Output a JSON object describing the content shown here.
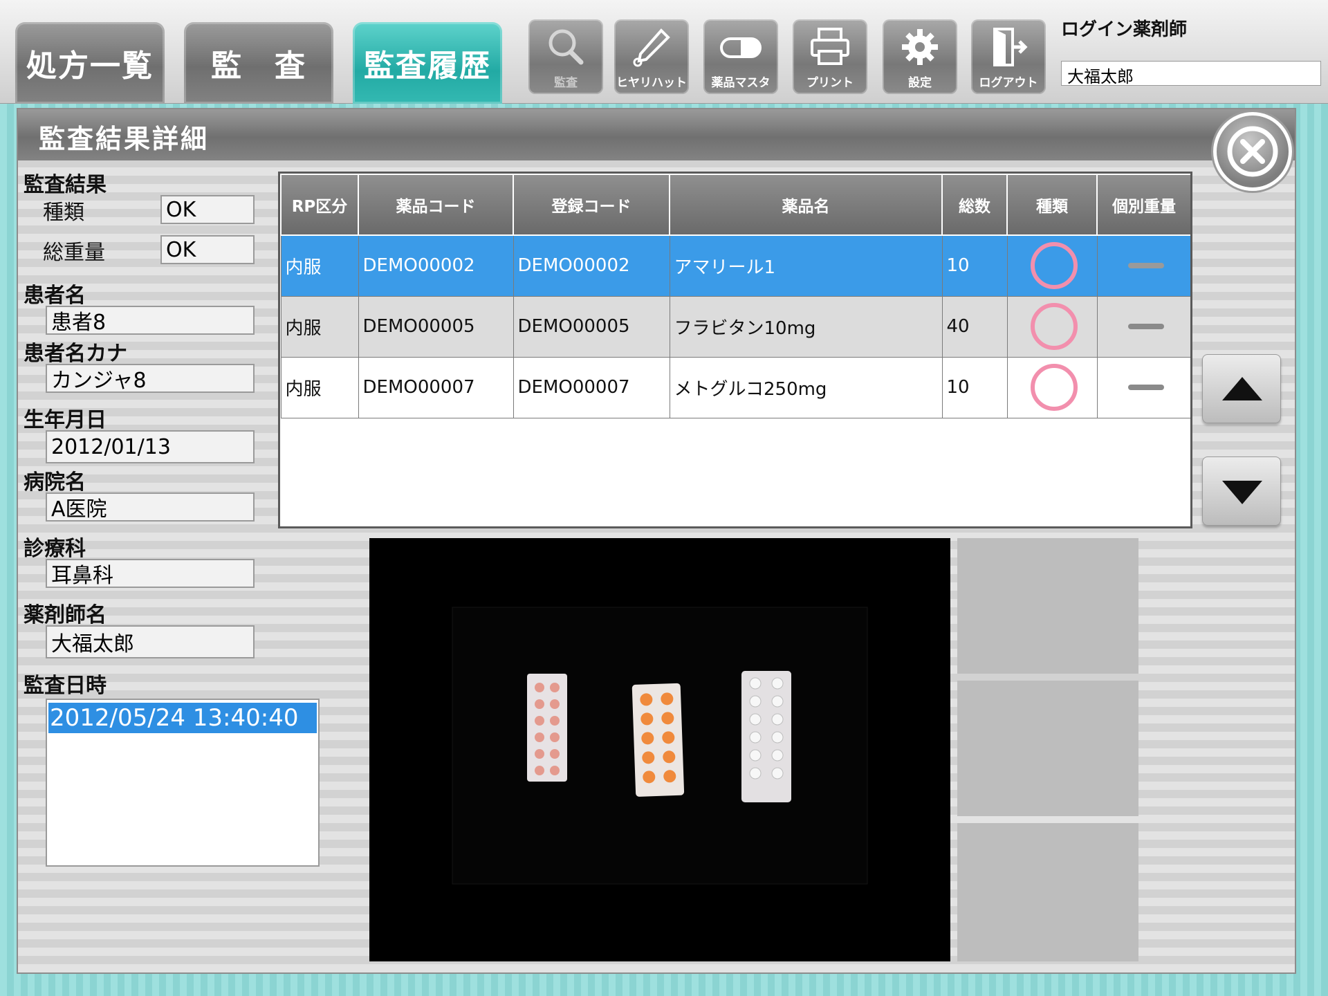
{
  "topbar": {
    "tabs": [
      {
        "label": "処方一覧",
        "active": false
      },
      {
        "label": "監　査",
        "active": false
      },
      {
        "label": "監査履歴",
        "active": true
      }
    ],
    "tools": [
      {
        "label": "監査",
        "icon": "magnifier-icon",
        "enabled": false
      },
      {
        "label": "ヒヤリハット",
        "icon": "pen-icon",
        "enabled": true
      },
      {
        "label": "薬品マスタ",
        "icon": "pill-capsule-icon",
        "enabled": true
      },
      {
        "label": "プリント",
        "icon": "printer-icon",
        "enabled": true
      },
      {
        "label": "設定",
        "icon": "gear-icon",
        "enabled": true
      },
      {
        "label": "ログアウト",
        "icon": "door-exit-icon",
        "enabled": true
      }
    ],
    "login_label": "ログイン薬剤師",
    "login_name": "大福太郎"
  },
  "panel": {
    "title": "監査結果詳細",
    "close_icon": "close-circle-icon"
  },
  "info": {
    "audit_result_label": "監査結果",
    "kind_label": "種類",
    "kind_value": "OK",
    "total_weight_label": "総重量",
    "total_weight_value": "OK",
    "patient_name_label": "患者名",
    "patient_name": "患者8",
    "patient_kana_label": "患者名カナ",
    "patient_kana": "カンジャ8",
    "birth_label": "生年月日",
    "birth": "2012/01/13",
    "hospital_label": "病院名",
    "hospital": "A医院",
    "dept_label": "診療科",
    "dept": "耳鼻科",
    "pharmacist_label": "薬剤師名",
    "pharmacist": "大福太郎",
    "audit_datetime_label": "監査日時",
    "audit_datetimes": [
      "2012/05/24 13:40:40"
    ]
  },
  "table": {
    "columns": [
      "RP区分",
      "薬品コード",
      "登録コード",
      "薬品名",
      "総数",
      "種類",
      "個別重量"
    ],
    "rows": [
      {
        "rp": "内服",
        "code": "DEMO00002",
        "reg": "DEMO00002",
        "name": "アマリール1",
        "count": "10",
        "kind": "circle-ok-icon",
        "weight": "dash-icon",
        "selected": true
      },
      {
        "rp": "内服",
        "code": "DEMO00005",
        "reg": "DEMO00005",
        "name": "フラビタン10mg",
        "count": "40",
        "kind": "circle-ok-icon",
        "weight": "dash-icon",
        "selected": false
      },
      {
        "rp": "内服",
        "code": "DEMO00007",
        "reg": "DEMO00007",
        "name": "メトグルコ250mg",
        "count": "10",
        "kind": "circle-ok-icon",
        "weight": "dash-icon",
        "selected": false
      }
    ]
  },
  "scroll": {
    "up_icon": "triangle-up-icon",
    "down_icon": "triangle-down-icon"
  },
  "colors": {
    "accent_teal": "#22aaa4",
    "selection_blue": "#3b9be8",
    "ok_ring_pink": "#f28fad"
  }
}
